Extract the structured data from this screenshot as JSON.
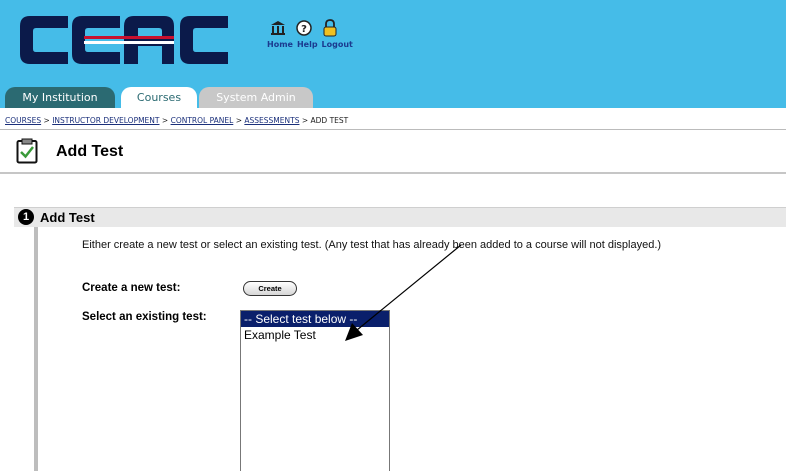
{
  "header": {
    "logo_text": "CCAC",
    "links": {
      "home": "Home",
      "help": "Help",
      "logout": "Logout"
    },
    "icons": [
      "institution-icon",
      "help-icon",
      "padlock-icon"
    ],
    "colors": {
      "header_bg": "#45bce8",
      "logo": "#0b1a4a",
      "tab_active": "#2b6a72"
    }
  },
  "tabs": [
    {
      "label": "My Institution"
    },
    {
      "label": "Courses"
    },
    {
      "label": "System Admin"
    }
  ],
  "breadcrumb": {
    "items": [
      "COURSES",
      "INSTRUCTOR DEVELOPMENT",
      "CONTROL PANEL",
      "ASSESSMENTS",
      "ADD TEST"
    ],
    "separator": ">"
  },
  "page": {
    "title": "Add Test"
  },
  "section": {
    "step": "1",
    "title": "Add Test",
    "instructions": "Either create a new test or select an existing test. (Any test that has already been added to a course will not displayed.)",
    "create_label": "Create a new test:",
    "create_button": "Create",
    "select_label": "Select an existing test:",
    "select_options": [
      "-- Select test below --",
      "Example Test"
    ]
  }
}
